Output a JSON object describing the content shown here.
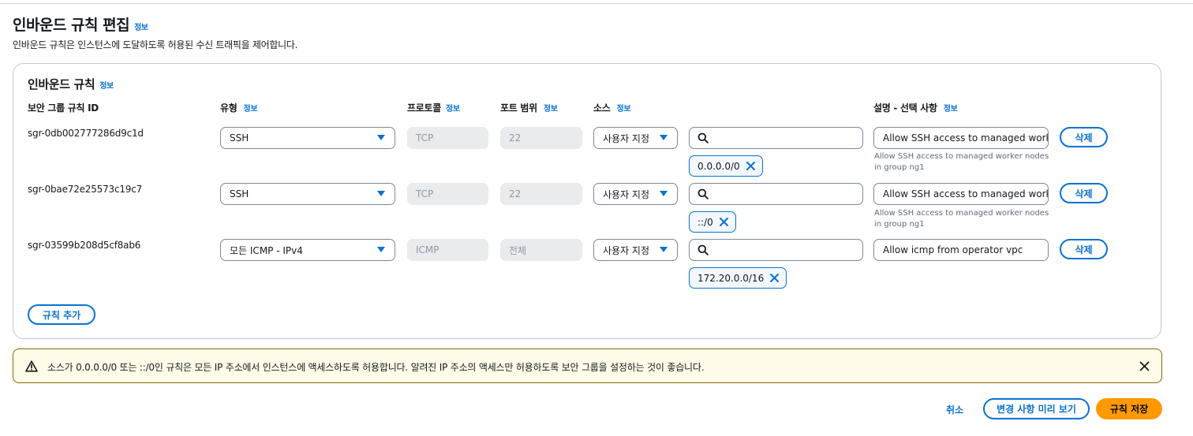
{
  "page": {
    "title": "인바운드 규칙 편집",
    "title_info": "정보",
    "description": "인바운드 규칙은 인스턴스에 도달하도록 허용된 수신 트래픽을 제어합니다."
  },
  "panel": {
    "title": "인바운드 규칙",
    "title_info": "정보",
    "columns": {
      "rule_id": "보안 그룹 규칙 ID",
      "type": "유형",
      "protocol": "프로토콜",
      "port_range": "포트 범위",
      "source": "소스",
      "description": "설명 - 선택 사항",
      "info": "정보"
    },
    "rows": [
      {
        "rule_id": "sgr-0db002777286d9c1d",
        "type": "SSH",
        "protocol": "TCP",
        "port_range": "22",
        "source": "사용자 지정",
        "cidr": "0.0.0.0/0",
        "description": "Allow SSH access to managed worker nodes in group ng1",
        "description_help": "Allow SSH access to managed worker nodes in group ng1",
        "delete": "삭제"
      },
      {
        "rule_id": "sgr-0bae72e25573c19c7",
        "type": "SSH",
        "protocol": "TCP",
        "port_range": "22",
        "source": "사용자 지정",
        "cidr": "::/0",
        "description": "Allow SSH access to managed worker nodes in group ng1",
        "description_help": "Allow SSH access to managed worker nodes in group ng1",
        "delete": "삭제"
      },
      {
        "rule_id": "sgr-03599b208d5cf8ab6",
        "type": "모든 ICMP - IPv4",
        "protocol": "ICMP",
        "port_range": "전체",
        "source": "사용자 지정",
        "cidr": "172.20.0.0/16",
        "description": "Allow icmp from operator vpc",
        "delete": "삭제"
      }
    ],
    "add_rule": "규칙 추가"
  },
  "alert": {
    "message": "소스가 0.0.0.0/0 또는 ::/0인 규칙은 모든 IP 주소에서 인스턴스에 액세스하도록 허용합니다. 알려진 IP 주소의 액세스만 허용하도록 보안 그룹을 설정하는 것이 좋습니다."
  },
  "footer": {
    "cancel": "취소",
    "preview": "변경 사항 미리 보기",
    "save": "규칙 저장"
  },
  "colors": {
    "accent": "#0972d3",
    "primary_button": "#ff9900",
    "warning_border": "#8d6605",
    "warning_bg": "#fffce9"
  }
}
